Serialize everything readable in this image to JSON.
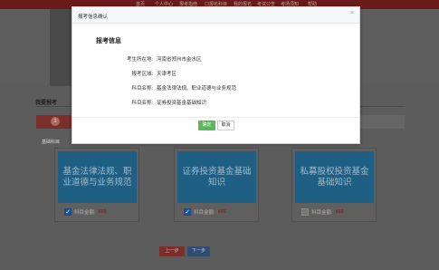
{
  "topnav": [
    "首页",
    "个人中心",
    "报考指南",
    "口报名科目",
    "我的报名",
    "考试公告",
    "考场须知",
    "帮助"
  ],
  "page": {
    "title": "我要报考",
    "step_number": "1",
    "section_label": "基础科目"
  },
  "courses": [
    {
      "name": "基金法律法规、职业道德与业务规范",
      "checked": true,
      "check_glyph": "✓",
      "price_label": "科目金额:",
      "price": "¥65"
    },
    {
      "name": "证券投资基金基础知识",
      "checked": true,
      "check_glyph": "✓",
      "price_label": "科目金额:",
      "price": "¥65"
    },
    {
      "name": "私募股权投资基金基础知识",
      "checked": false,
      "check_glyph": "",
      "price_label": "科目金额:",
      "price": "¥65"
    }
  ],
  "nav_buttons": {
    "prev": "上一步",
    "next": "下一步"
  },
  "modal": {
    "title": "报考信息确认",
    "close_glyph": "×",
    "info_title": "报考信息",
    "rows": [
      {
        "label": "考生所在地:",
        "value": "河南省郑州市金水区"
      },
      {
        "label": "报考区域:",
        "value": "天津考区"
      },
      {
        "label": "科目名称:",
        "value": "基金法律法规、职业道德与业务规范"
      },
      {
        "label": "科目名称:",
        "value": "证券投资基金基础知识"
      }
    ],
    "ok_label": "确定",
    "cancel_label": "取消"
  },
  "colors": {
    "brand": "#7a2f2a",
    "card_blue": "#1f5f84",
    "ok_green": "#5cb85c"
  }
}
